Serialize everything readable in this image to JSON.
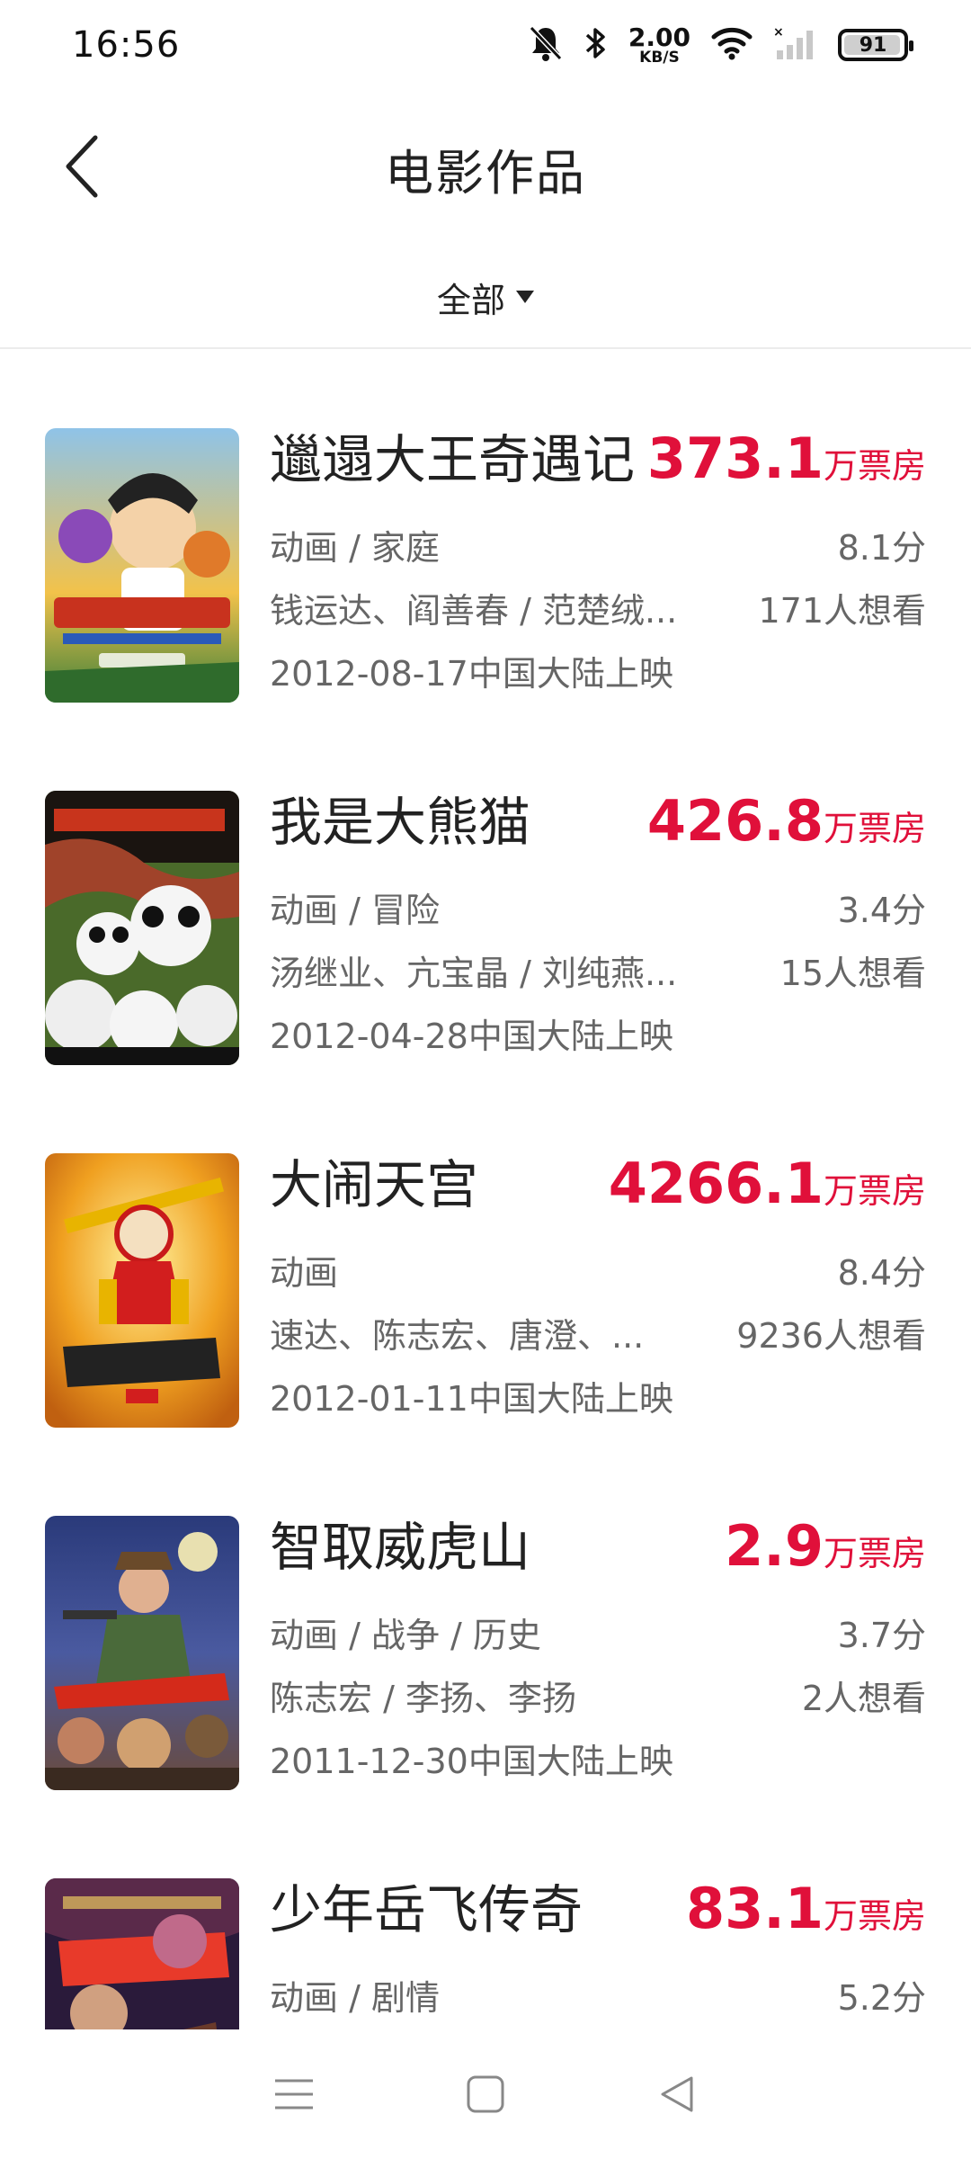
{
  "status": {
    "time": "16:56",
    "net_speed_value": "2.00",
    "net_speed_unit": "KB/S",
    "battery": "91"
  },
  "header": {
    "title": "电影作品"
  },
  "filter": {
    "label": "全部"
  },
  "box_unit": "万票房",
  "movies": [
    {
      "title": "邋遢大王奇遇记",
      "box_office": "373.1",
      "genre": "动画 / 家庭",
      "score": "8.1分",
      "cast": "钱运达、阎善春 / 范楚绒...",
      "want": "171人想看",
      "release": "2012-08-17中国大陆上映"
    },
    {
      "title": "我是大熊猫",
      "box_office": "426.8",
      "genre": "动画 / 冒险",
      "score": "3.4分",
      "cast": "汤继业、亢宝晶 / 刘纯燕...",
      "want": "15人想看",
      "release": "2012-04-28中国大陆上映"
    },
    {
      "title": "大闹天宫",
      "box_office": "4266.1",
      "genre": "动画",
      "score": "8.4分",
      "cast": "速达、陈志宏、唐澄、...",
      "want": "9236人想看",
      "release": "2012-01-11中国大陆上映"
    },
    {
      "title": "智取威虎山",
      "box_office": "2.9",
      "genre": "动画 / 战争 / 历史",
      "score": "3.7分",
      "cast": "陈志宏 / 李扬、李扬",
      "want": "2人想看",
      "release": "2011-12-30中国大陆上映"
    },
    {
      "title": "少年岳飞传奇",
      "box_office": "83.1",
      "genre": "动画 / 剧情",
      "score": "5.2分"
    }
  ]
}
